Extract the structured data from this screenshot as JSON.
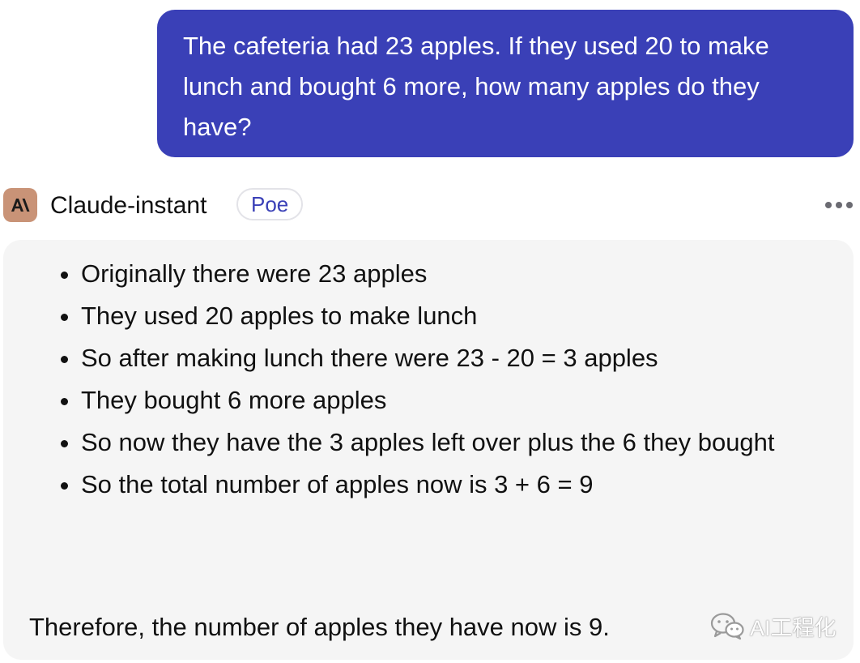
{
  "user_message": {
    "text": "The cafeteria had 23 apples. If they used 20 to make lunch and bought 6 more, how many apples do they have?"
  },
  "bot": {
    "avatar_icon": "anthropic-logo-icon",
    "avatar_text": "A\\",
    "avatar_color": "#c99377",
    "name": "Claude-instant",
    "badge": "Poe",
    "more_icon": "more-horizontal-icon"
  },
  "bot_message": {
    "bullets": [
      "Originally there were 23 apples",
      "They used 20 apples to make lunch",
      "So after making lunch there were 23 - 20 = 3 apples",
      "They bought 6 more apples",
      "So now they have the 3 apples left over plus the 6 they bought",
      "So the total number of apples now is 3 + 6 = 9"
    ],
    "conclusion": "Therefore, the number of apples they have now is 9."
  },
  "watermark": {
    "icon": "wechat-icon",
    "text": "AI工程化"
  },
  "colors": {
    "user_bubble": "#3a40b7",
    "bot_bubble": "#f5f5f5",
    "badge_text": "#3a40b7"
  }
}
